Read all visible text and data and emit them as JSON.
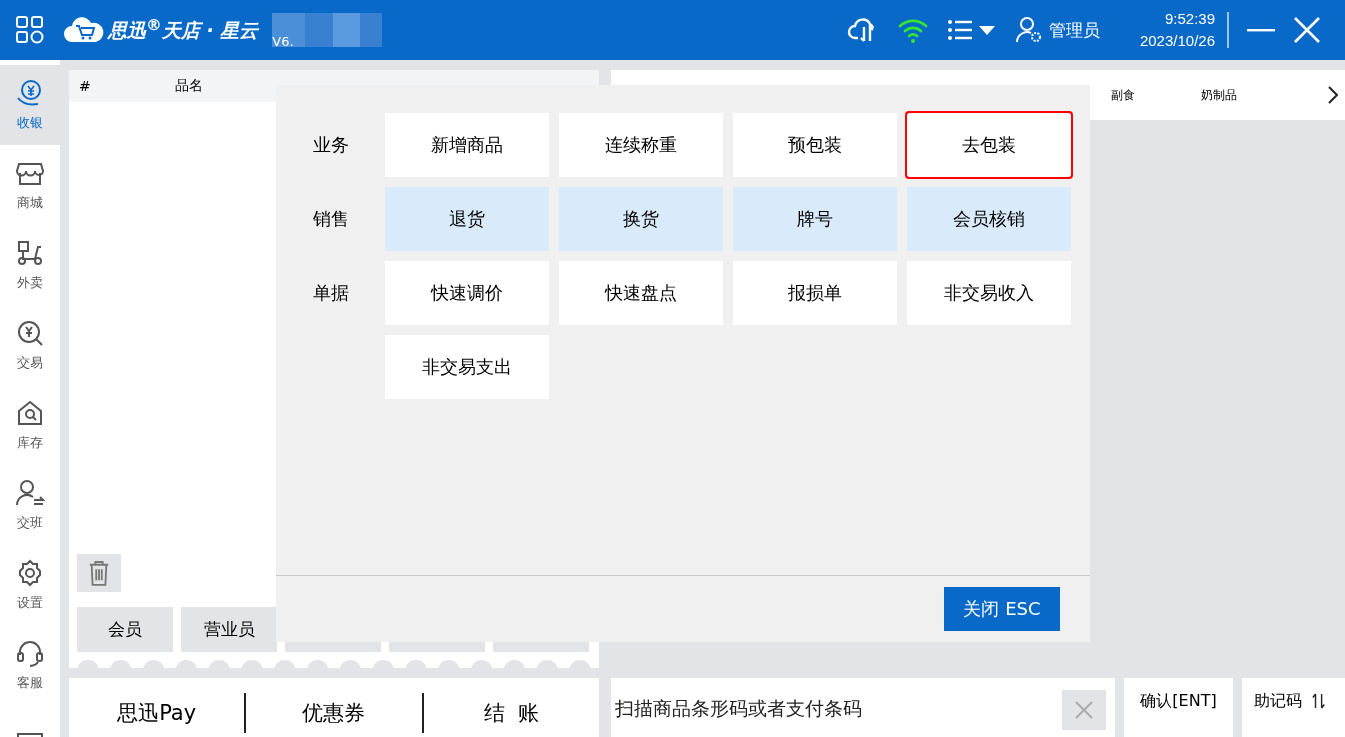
{
  "app": {
    "logo_text": "思迅$^{®}$天店 · 星云",
    "version": "V6."
  },
  "status": {
    "user": "管理员",
    "time": "9:52:39",
    "date": "2023/10/26"
  },
  "sidebar": [
    {
      "label": "收银",
      "selected": true
    },
    {
      "label": "商城",
      "selected": false
    },
    {
      "label": "外卖",
      "selected": false
    },
    {
      "label": "交易",
      "selected": false
    },
    {
      "label": "库存",
      "selected": false
    },
    {
      "label": "交班",
      "selected": false
    },
    {
      "label": "设置",
      "selected": false
    },
    {
      "label": "客服",
      "selected": false
    }
  ],
  "order_table": {
    "columns": [
      "#",
      "品名"
    ]
  },
  "order_buttons": [
    "会员",
    "营业员"
  ],
  "categories": [
    "副食",
    "奶制品"
  ],
  "menu": {
    "groups": [
      {
        "label": "业务",
        "kind": "plain",
        "items": [
          {
            "label": "新增商品",
            "highlighted": false
          },
          {
            "label": "连续称重",
            "highlighted": false
          },
          {
            "label": "预包装",
            "highlighted": false
          },
          {
            "label": "去包装",
            "highlighted": true
          }
        ]
      },
      {
        "label": "销售",
        "kind": "sales",
        "items": [
          {
            "label": "退货",
            "highlighted": false
          },
          {
            "label": "换货",
            "highlighted": false
          },
          {
            "label": "牌号",
            "highlighted": false
          },
          {
            "label": "会员核销",
            "highlighted": false
          }
        ]
      },
      {
        "label": "单据",
        "kind": "plain",
        "items": [
          {
            "label": "快速调价",
            "highlighted": false
          },
          {
            "label": "快速盘点",
            "highlighted": false
          },
          {
            "label": "报损单",
            "highlighted": false
          },
          {
            "label": "非交易收入",
            "highlighted": false
          },
          {
            "label": "非交易支出",
            "highlighted": false
          }
        ]
      }
    ],
    "close_button": "关闭 ESC"
  },
  "payment": [
    "思迅Pay",
    "优惠券",
    "结  账"
  ],
  "scan": {
    "placeholder": "扫描商品条形码或者支付条码"
  },
  "confirm_button": "确认[ENT]",
  "mnemonic_button": "助记码"
}
